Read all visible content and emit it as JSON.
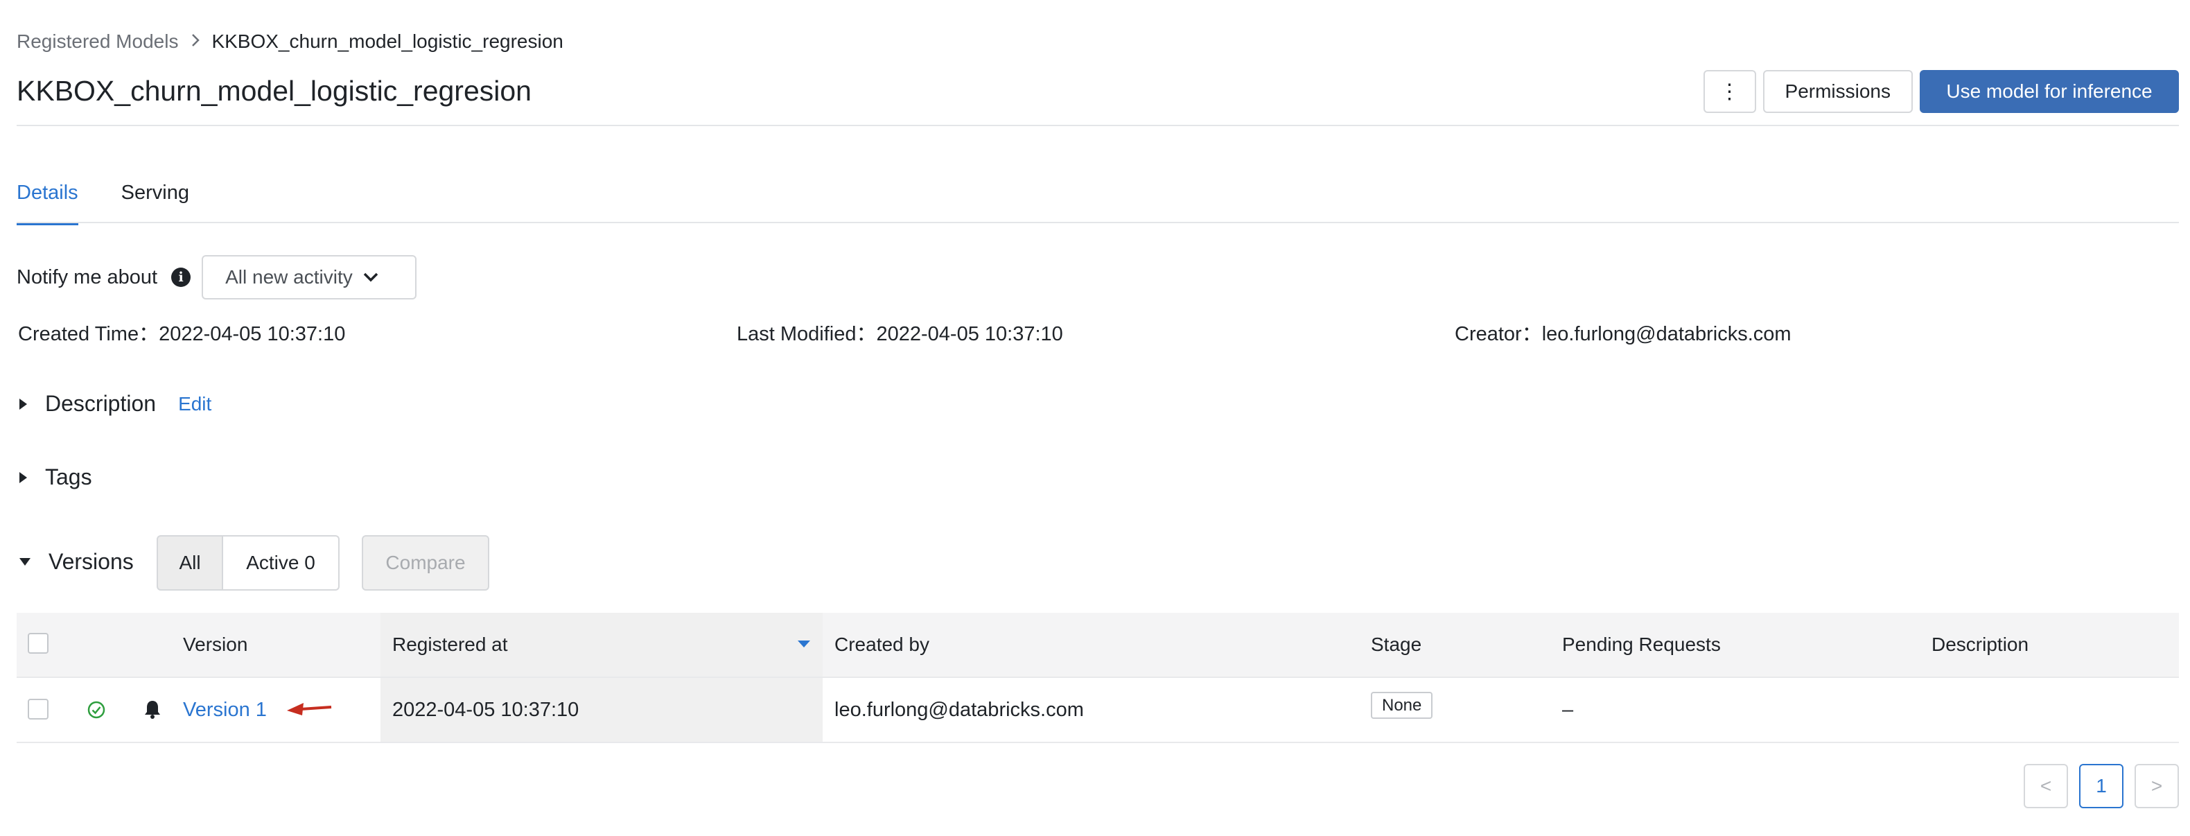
{
  "breadcrumb": {
    "parent": "Registered Models",
    "separator": "›",
    "current": "KKBOX_churn_model_logistic_regresion"
  },
  "page": {
    "title": "KKBOX_churn_model_logistic_regresion"
  },
  "header_actions": {
    "more": "⋮",
    "permissions": "Permissions",
    "use_model": "Use model for inference"
  },
  "tabs": [
    {
      "label": "Details",
      "active": true
    },
    {
      "label": "Serving",
      "active": false
    }
  ],
  "notify": {
    "label": "Notify me about",
    "info": "i",
    "value": "All new activity"
  },
  "metadata": {
    "created_label": "Created Time：",
    "created_value": "2022-04-05 10:37:10",
    "modified_label": "Last Modified：",
    "modified_value": "2022-04-05 10:37:10",
    "creator_label": "Creator：",
    "creator_value": "leo.furlong@databricks.com"
  },
  "sections": {
    "description": "Description",
    "edit": "Edit",
    "tags": "Tags",
    "versions": "Versions"
  },
  "versions_filter": {
    "all": "All",
    "active": "Active 0",
    "compare": "Compare"
  },
  "table": {
    "headers": [
      "Version",
      "Registered at",
      "Created by",
      "Stage",
      "Pending Requests",
      "Description"
    ],
    "rows": [
      {
        "version": "Version 1",
        "registered_at": "2022-04-05 10:37:10",
        "created_by": "leo.furlong@databricks.com",
        "stage": "None",
        "pending": "–",
        "description": ""
      }
    ]
  },
  "pagination": {
    "prev": "<",
    "page": "1",
    "next": ">"
  },
  "colors": {
    "accent": "#2a75d0",
    "primary_button": "#3a6db5",
    "status_ok": "#2e9e3e",
    "annotation_arrow": "#c62d1f"
  }
}
